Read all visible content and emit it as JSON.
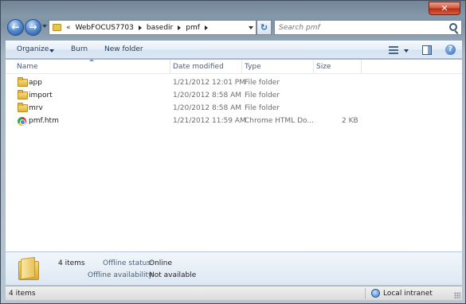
{
  "window": {
    "close_glyph": "✕"
  },
  "nav": {
    "back_glyph": "←",
    "forward_glyph": "→",
    "breadcrumb_overflow": "«",
    "breadcrumbs": [
      "WebFOCUS7703",
      "basedir",
      "pmf"
    ],
    "refresh_glyph": "↻",
    "search_placeholder": "Search pmf"
  },
  "commands": {
    "organize": "Organize",
    "burn": "Burn",
    "new_folder": "New folder",
    "help_glyph": "?"
  },
  "columns": {
    "name": "Name",
    "date_modified": "Date modified",
    "type": "Type",
    "size": "Size"
  },
  "files": [
    {
      "name": "app",
      "date": "1/21/2012 12:01 PM",
      "type": "File folder",
      "size": "",
      "icon": "folder-icon"
    },
    {
      "name": "import",
      "date": "1/20/2012 8:58 AM",
      "type": "File folder",
      "size": "",
      "icon": "folder-icon"
    },
    {
      "name": "mrv",
      "date": "1/20/2012 8:58 AM",
      "type": "File folder",
      "size": "",
      "icon": "folder-icon"
    },
    {
      "name": "pmf.htm",
      "date": "1/21/2012 11:59 AM",
      "type": "Chrome HTML Do...",
      "size": "2 KB",
      "icon": "chrome-html-icon"
    }
  ],
  "details": {
    "count": "4 items",
    "offline_status_label": "Offline status:",
    "offline_status_value": "Online",
    "offline_availability_label": "Offline availability:",
    "offline_availability_value": "Not available"
  },
  "status": {
    "items": "4 items",
    "zone": "Local intranet"
  }
}
